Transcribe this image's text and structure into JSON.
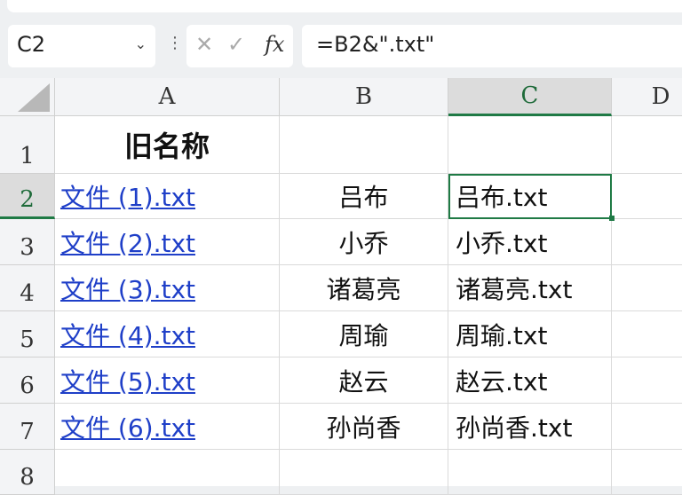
{
  "name_box": {
    "value": "C2"
  },
  "formula_bar": {
    "value": "=B2&\".txt\"",
    "cancel": "✕",
    "confirm": "✓",
    "fx": "fx"
  },
  "columns": [
    "A",
    "B",
    "C",
    "D"
  ],
  "rows": [
    "1",
    "2",
    "3",
    "4",
    "5",
    "6",
    "7",
    "8"
  ],
  "selected_cell": "C2",
  "accent": "#1f7a45",
  "link_color": "#1f3fc8",
  "cells": {
    "A1": "旧名称",
    "A": [
      "文件 (1).txt",
      "文件 (2).txt",
      "文件 (3).txt",
      "文件 (4).txt",
      "文件 (5).txt",
      "文件 (6).txt"
    ],
    "B": [
      "吕布",
      "小乔",
      "诸葛亮",
      "周瑜",
      "赵云",
      "孙尚香"
    ],
    "C": [
      "吕布.txt",
      "小乔.txt",
      "诸葛亮.txt",
      "周瑜.txt",
      "赵云.txt",
      "孙尚香.txt"
    ]
  }
}
